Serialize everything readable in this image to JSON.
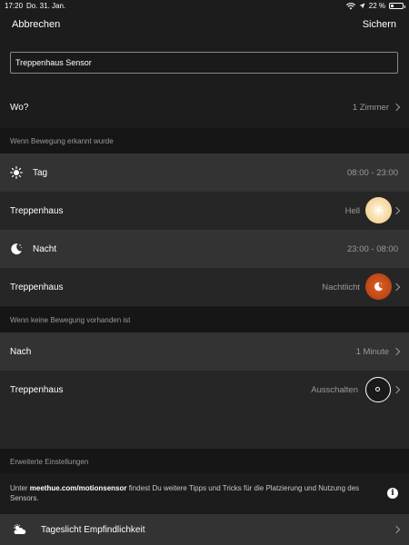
{
  "status_bar": {
    "time": "17:20",
    "date": "Do. 31. Jan.",
    "battery_percent": "22 %"
  },
  "nav": {
    "cancel_label": "Abbrechen",
    "save_label": "Sichern"
  },
  "name_field": {
    "value": "Treppenhaus Sensor"
  },
  "where": {
    "label": "Wo?",
    "value": "1 Zimmer"
  },
  "section_motion": "Wenn Bewegung erkannt wurde",
  "day": {
    "label": "Tag",
    "time_range": "08:00 - 23:00",
    "icon": "sun-icon"
  },
  "day_room": {
    "label": "Treppenhaus",
    "scene": "Hell",
    "color": "#f6d9a4"
  },
  "night": {
    "label": "Nacht",
    "time_range": "23:00 - 08:00",
    "icon": "moon-icon"
  },
  "night_room": {
    "label": "Treppenhaus",
    "scene": "Nachtlicht",
    "color": "#c24a16"
  },
  "section_no_motion": "Wenn keine Bewegung vorhanden ist",
  "after": {
    "label": "Nach",
    "value": "1 Minute"
  },
  "off_room": {
    "label": "Treppenhaus",
    "scene": "Ausschalten"
  },
  "section_advanced": "Erweiterte Einstellungen",
  "info": {
    "prefix": "Unter ",
    "link": "meethue.com/motionsensor",
    "suffix": " findest Du weitere Tipps und Tricks für die Platzierung und Nutzung des Sensors."
  },
  "daylight": {
    "label": "Tageslicht Empfindlichkeit",
    "icon": "partly-cloudy-icon"
  }
}
